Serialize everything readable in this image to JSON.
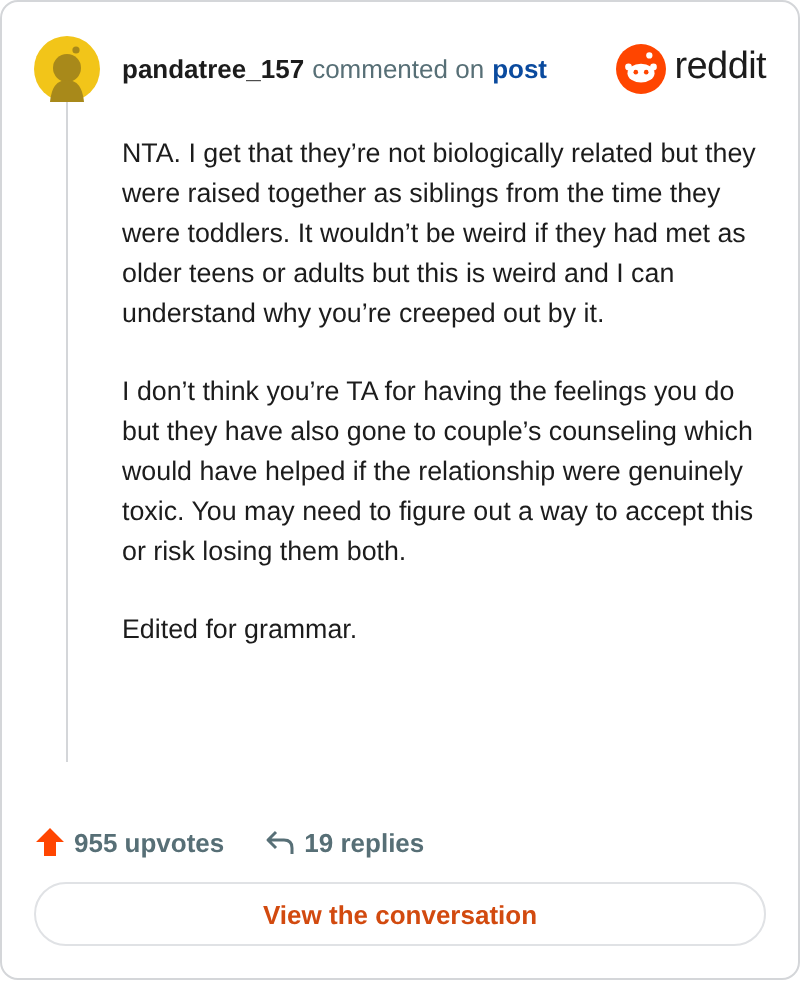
{
  "author": {
    "username": "pandatree_157",
    "action": "commented on",
    "link": "post"
  },
  "brand": {
    "name": "reddit"
  },
  "paragraphs": [
    "NTA. I get that they’re not biologically related but they were raised together as siblings from the time they were toddlers. It wouldn’t be weird if they had met as older teens or adults but this is weird and I can understand why you’re creeped out by it.",
    "I don’t think you’re TA for having the feelings you do but they have also gone to couple’s counseling which would have helped if the relationship were genuinely toxic. You may need to figure out a way to accept this or risk losing them both.",
    "Edited for grammar."
  ],
  "stats": {
    "upvotes": "955 upvotes",
    "replies": "19 replies"
  },
  "button": {
    "label": "View the conversation"
  }
}
